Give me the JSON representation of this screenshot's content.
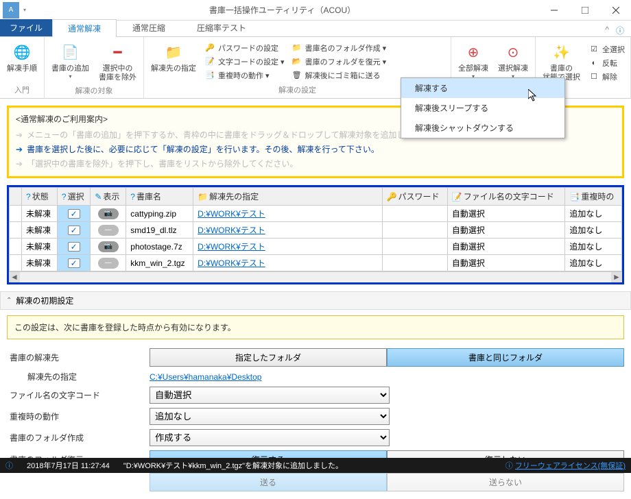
{
  "window": {
    "title": "書庫一括操作ユーティリティ（ACOU）"
  },
  "tabs": {
    "file": "ファイル",
    "items": [
      "通常解凍",
      "通常圧縮",
      "圧縮率テスト"
    ],
    "active": 0
  },
  "ribbon": {
    "group1": {
      "label": "入門",
      "btn1": "解凍手順"
    },
    "group2": {
      "label": "解凍の対象",
      "btn1": "書庫の追加",
      "btn2": "選択中の\n書庫を除外"
    },
    "group3": {
      "label": "解凍の設定",
      "btn1": "解凍先の指定",
      "list1": [
        "パスワードの設定",
        "文字コードの設定 ▾",
        "重複時の動作 ▾"
      ],
      "list2": [
        "書庫名のフォルダ作成 ▾",
        "書庫のフォルダを復元 ▾",
        "解凍後にゴミ箱に送る"
      ]
    },
    "group4": {
      "btn1": "全部解凍",
      "btn2": "選択解凍"
    },
    "group5": {
      "btn1": "書庫の\n状態で選択",
      "list": [
        "全選択",
        "反転",
        "解除"
      ]
    }
  },
  "dropdown": {
    "items": [
      "解凍する",
      "解凍後スリープする",
      "解凍後シャットダウンする"
    ],
    "hover": 0
  },
  "info": {
    "title": "<通常解凍のご利用案内>",
    "lines": [
      {
        "text": "メニューの「書庫の追加」を押下するか、青枠の中に書庫をドラッグ＆ドロップして解凍対象を追加し",
        "active": false
      },
      {
        "text": "書庫を選択した後に、必要に応じて「解凍の設定」を行います。その後、解凍を行って下さい。",
        "active": true
      },
      {
        "text": "「選択中の書庫を除外」を押下し、書庫をリストから除外してください。",
        "active": false
      }
    ]
  },
  "table": {
    "headers": [
      "状態",
      "選択",
      "表示",
      "書庫名",
      "解凍先の指定",
      "パスワード",
      "ファイル名の文字コード",
      "重複時の"
    ],
    "rows": [
      {
        "status": "未解凍",
        "checked": true,
        "disp": "cam",
        "name": "cattyping.zip",
        "dest": "D:¥WORK¥テスト",
        "pw": "",
        "enc": "自動選択",
        "dup": "追加なし"
      },
      {
        "status": "未解凍",
        "checked": true,
        "disp": "dash",
        "name": "smd19_dl.tlz",
        "dest": "D:¥WORK¥テスト",
        "pw": "",
        "enc": "自動選択",
        "dup": "追加なし"
      },
      {
        "status": "未解凍",
        "checked": true,
        "disp": "cam",
        "name": "photostage.7z",
        "dest": "D:¥WORK¥テスト",
        "pw": "",
        "enc": "自動選択",
        "dup": "追加なし"
      },
      {
        "status": "未解凍",
        "checked": true,
        "disp": "dash",
        "name": "kkm_win_2.tgz",
        "dest": "D:¥WORK¥テスト",
        "pw": "",
        "enc": "自動選択",
        "dup": "追加なし"
      }
    ]
  },
  "settings": {
    "header": "解凍の初期設定",
    "note": "この設定は、次に書庫を登録した時点から有効になります。",
    "dest_label": "書庫の解凍先",
    "dest_opt1": "指定したフォルダ",
    "dest_opt2": "書庫と同じフォルダ",
    "dest_active": 1,
    "dest_sub_label": "解凍先の指定",
    "dest_sub_link": "C:¥Users¥hamanaka¥Desktop",
    "enc_label": "ファイル名の文字コード",
    "enc_value": "自動選択",
    "dup_label": "重複時の動作",
    "dup_value": "追加なし",
    "mkdir_label": "書庫のフォルダ作成",
    "mkdir_value": "作成する",
    "restore_label": "書庫のフォルダ復元",
    "restore_opt1": "復元する",
    "restore_opt2": "復元しない",
    "restore_active": 0,
    "last_opt1": "送る",
    "last_opt2": "送らない"
  },
  "status": {
    "datetime": "2018年7月17日 11:27:44",
    "message": "\"D:¥WORK¥テスト¥kkm_win_2.tgz\"を解凍対象に追加しました。",
    "license": "フリーウェアライセンス(無保証)"
  }
}
